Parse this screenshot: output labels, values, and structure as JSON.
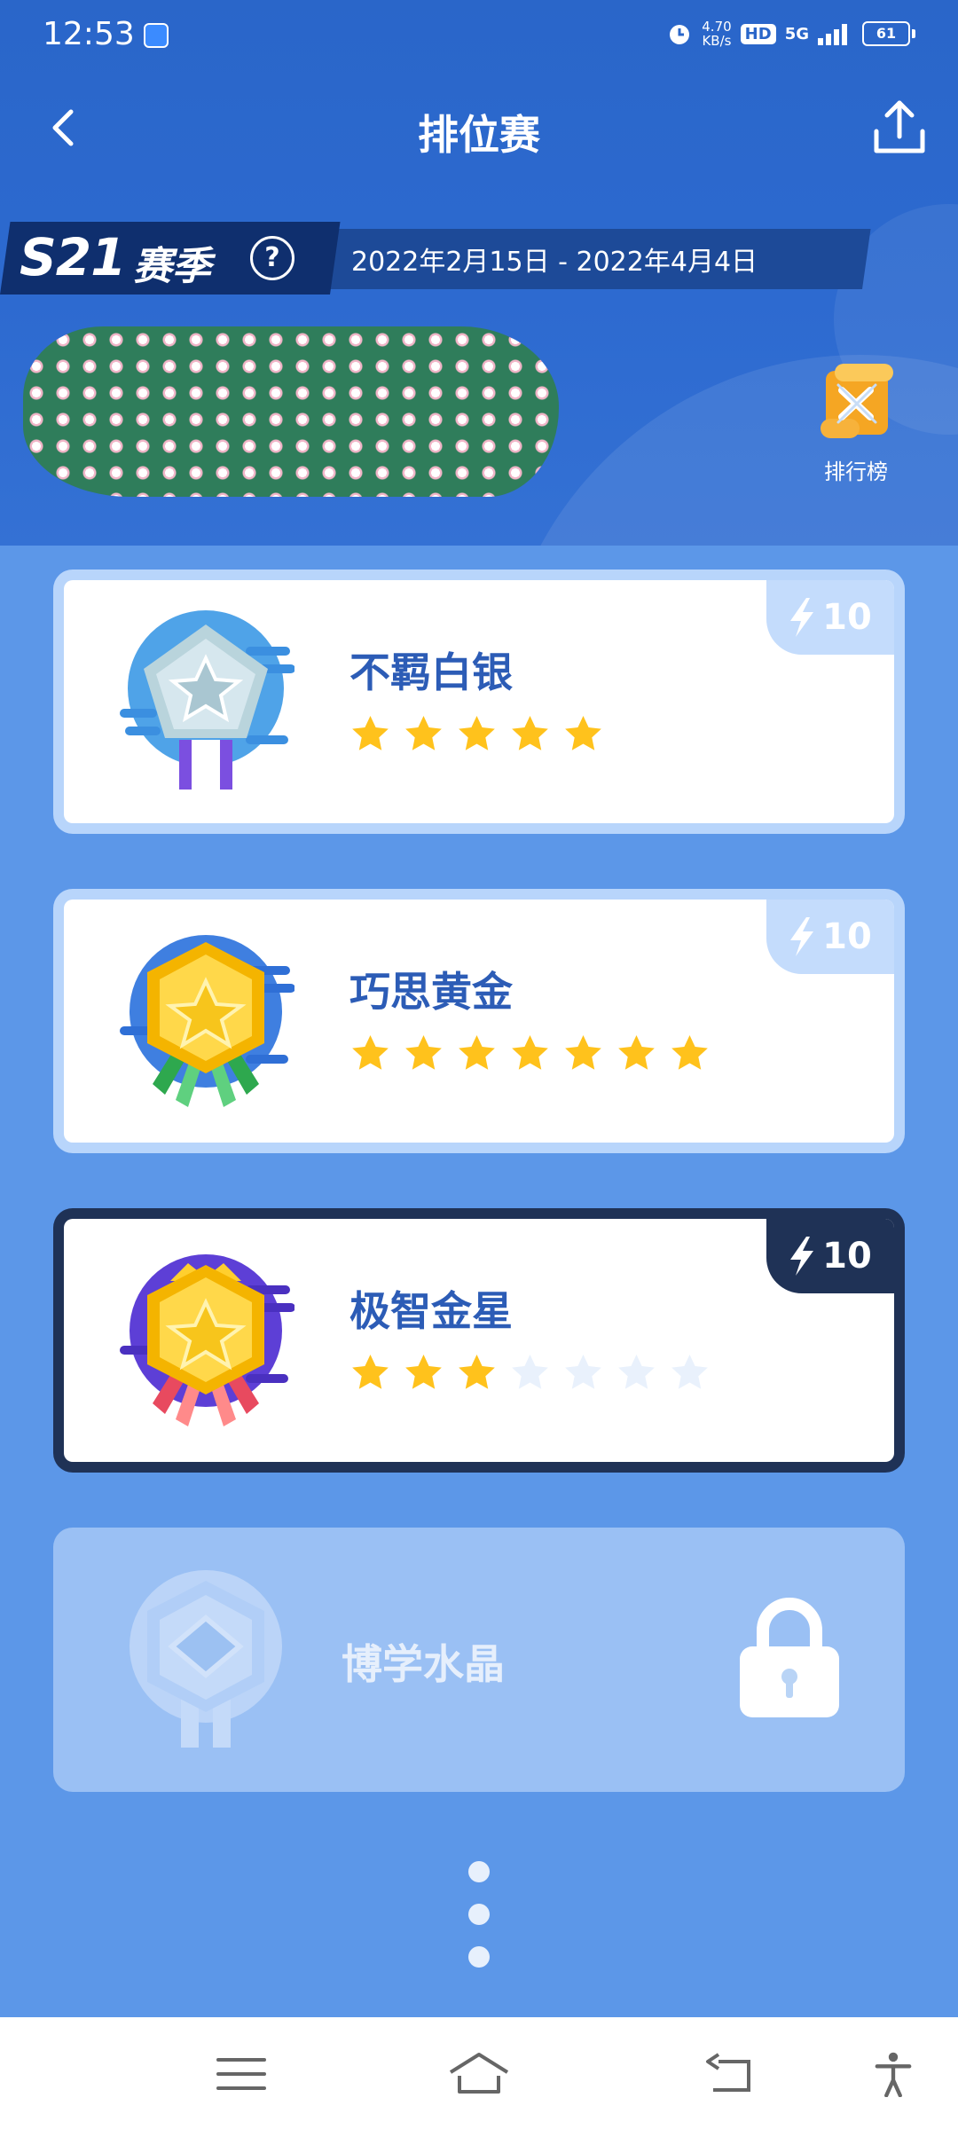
{
  "status_bar": {
    "time": "12:53",
    "net_speed_value": "4.70",
    "net_speed_unit": "KB/s",
    "hd": "HD",
    "network": "5G",
    "battery": "61"
  },
  "header": {
    "title": "排位赛"
  },
  "season": {
    "code": "S21",
    "label": "赛季",
    "help": "?",
    "dates": "2022年2月15日 - 2022年4月4日"
  },
  "leaderboard": {
    "label": "排行榜"
  },
  "tiers": [
    {
      "name": "不羁白银",
      "energy": "10",
      "stars_filled": 5,
      "stars_total": 5,
      "state": "completed"
    },
    {
      "name": "巧思黄金",
      "energy": "10",
      "stars_filled": 7,
      "stars_total": 7,
      "state": "completed"
    },
    {
      "name": "极智金星",
      "energy": "10",
      "stars_filled": 3,
      "stars_total": 7,
      "state": "current"
    },
    {
      "name": "博学水晶",
      "state": "locked"
    }
  ],
  "colors": {
    "header_bg": "#2a66c9",
    "page_bg": "#5c97e8",
    "title_text": "#2c5cb6",
    "star_gold": "#ffc21c",
    "star_empty": "#e9f1fc",
    "current_border": "#1f3256"
  },
  "icons": [
    "back-arrow-icon",
    "share-icon",
    "help-icon",
    "leaderboard-scroll-icon",
    "lightning-icon",
    "star-icon",
    "lock-icon",
    "menu-icon",
    "home-icon",
    "back-icon",
    "accessibility-icon"
  ]
}
